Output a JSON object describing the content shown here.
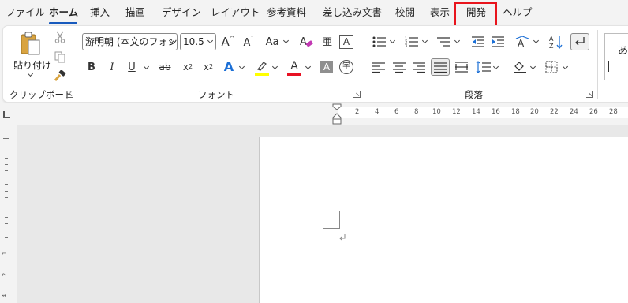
{
  "tabs": [
    {
      "label": "ファイル"
    },
    {
      "label": "ホーム"
    },
    {
      "label": "挿入"
    },
    {
      "label": "描画"
    },
    {
      "label": "デザイン"
    },
    {
      "label": "レイアウト"
    },
    {
      "label": "参考資料"
    },
    {
      "label": "差し込み文書"
    },
    {
      "label": "校閲"
    },
    {
      "label": "表示"
    },
    {
      "label": "開発"
    },
    {
      "label": "ヘルプ"
    }
  ],
  "active_tab": "ホーム",
  "highlighted_tab": "開発",
  "clipboard": {
    "paste_label": "貼り付け",
    "group_label": "クリップボード"
  },
  "font": {
    "font_name": "游明朝 (本文のフォン",
    "font_size": "10.5",
    "grow_label": "A",
    "shrink_label": "A",
    "case_label": "Aa",
    "bold": "B",
    "italic": "I",
    "underline": "U",
    "strike": "ab",
    "subscript": "x",
    "subscript_mark": "2",
    "superscript": "x",
    "superscript_mark": "2",
    "effects": "A",
    "color": "A",
    "shade": "A",
    "border_char": "A",
    "enclosed_char": "字",
    "ruby": "亜",
    "group_label": "フォント"
  },
  "paragraph": {
    "group_label": "段落"
  },
  "styles": {
    "preview": "あ"
  },
  "colors": {
    "highlight_box": "#e8141c",
    "active_underline": "#185abd",
    "font_color_bar": "#e81123",
    "highlighter_bar": "#ffff00"
  },
  "ruler": {
    "ticks": [
      "2",
      "4",
      "6",
      "8",
      "10",
      "12",
      "14",
      "16",
      "18",
      "20",
      "22",
      "24",
      "26",
      "28"
    ],
    "vertical_ticks": [
      "1",
      "2",
      "4"
    ]
  }
}
